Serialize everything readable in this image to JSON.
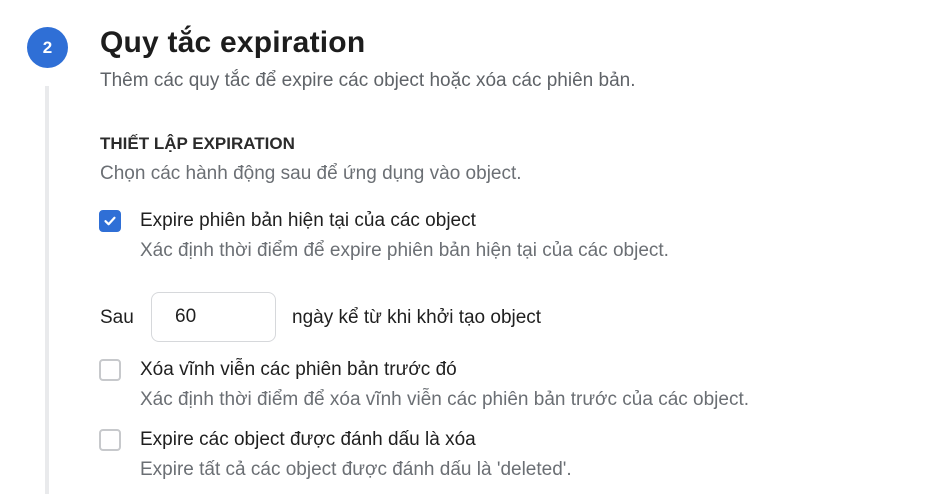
{
  "step": {
    "number": "2",
    "title": "Quy tắc expiration",
    "subtitle": "Thêm các quy tắc để expire các object hoặc xóa các phiên bản."
  },
  "section": {
    "heading": "THIẾT LẬP EXPIRATION",
    "description": "Chọn các hành động sau để ứng dụng vào object."
  },
  "options": [
    {
      "label": "Expire phiên bản hiện tại của các object",
      "description": "Xác định thời điểm để expire phiên bản hiện tại của các object.",
      "checked": true
    },
    {
      "label": "Xóa vĩnh viễn các phiên bản trước đó",
      "description": "Xác định thời điểm để xóa vĩnh viễn các phiên bản trước của các object.",
      "checked": false
    },
    {
      "label": "Expire các object được đánh dấu là xóa",
      "description": "Expire tất cả các object được đánh dấu là 'deleted'.",
      "checked": false
    }
  ],
  "days_field": {
    "prefix": "Sau",
    "value": "60",
    "suffix": "ngày kể từ khi khởi tạo object"
  },
  "colors": {
    "accent": "#2f6fd6",
    "muted_text": "#6b6f74",
    "border": "#d6d8db"
  }
}
